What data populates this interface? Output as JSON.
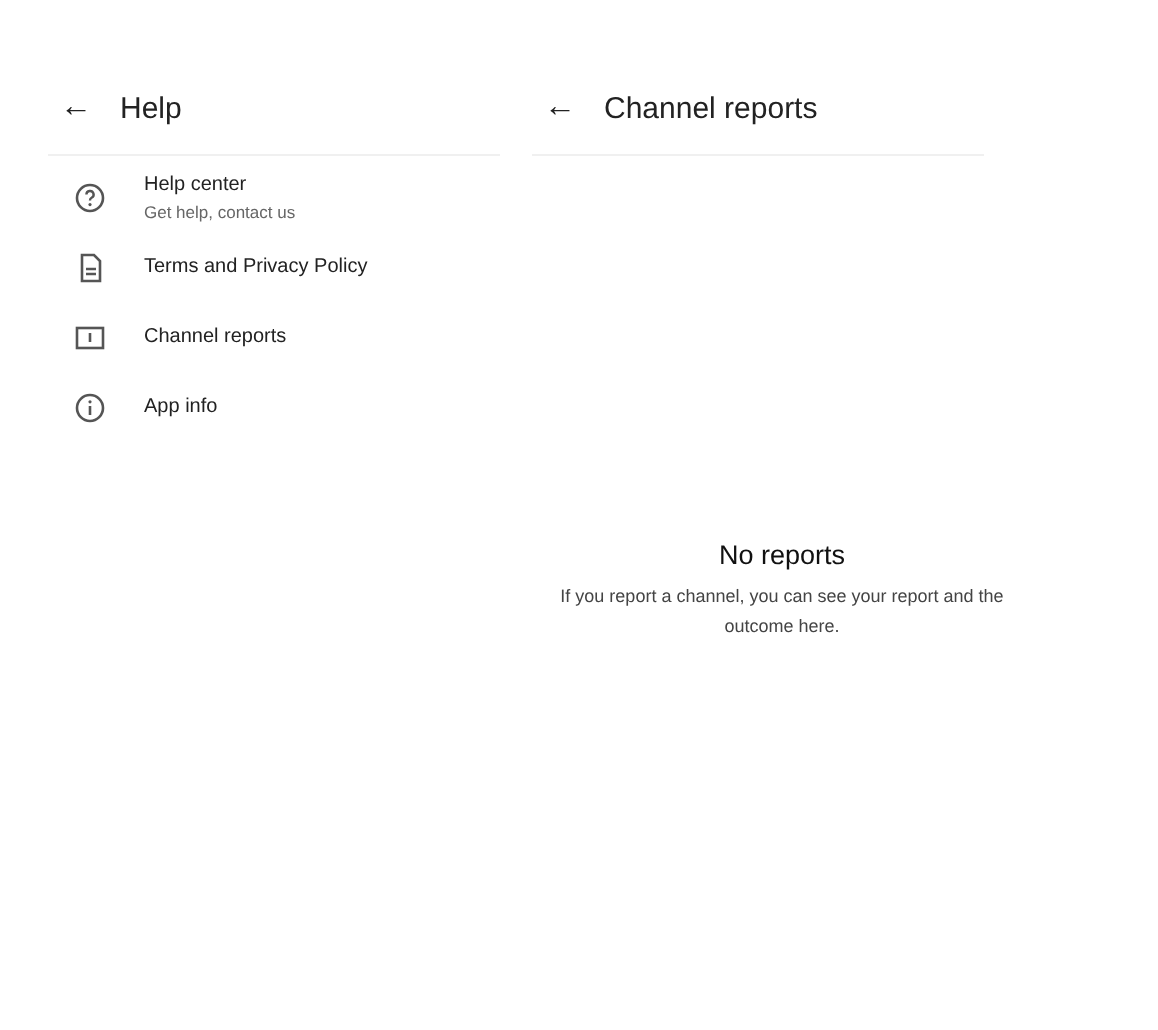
{
  "help_screen": {
    "title": "Help",
    "back": "←",
    "items": [
      {
        "kind": "help",
        "title": "Help center",
        "subtitle": "Get help, contact us"
      },
      {
        "kind": "document",
        "title": "Terms and Privacy Policy"
      },
      {
        "kind": "report",
        "title": "Channel reports"
      },
      {
        "kind": "info",
        "title": "App info"
      }
    ]
  },
  "reports_screen": {
    "title": "Channel reports",
    "back": "←",
    "empty_title": "No reports",
    "empty_message": "If you report a channel, you can see your report and the outcome here."
  }
}
